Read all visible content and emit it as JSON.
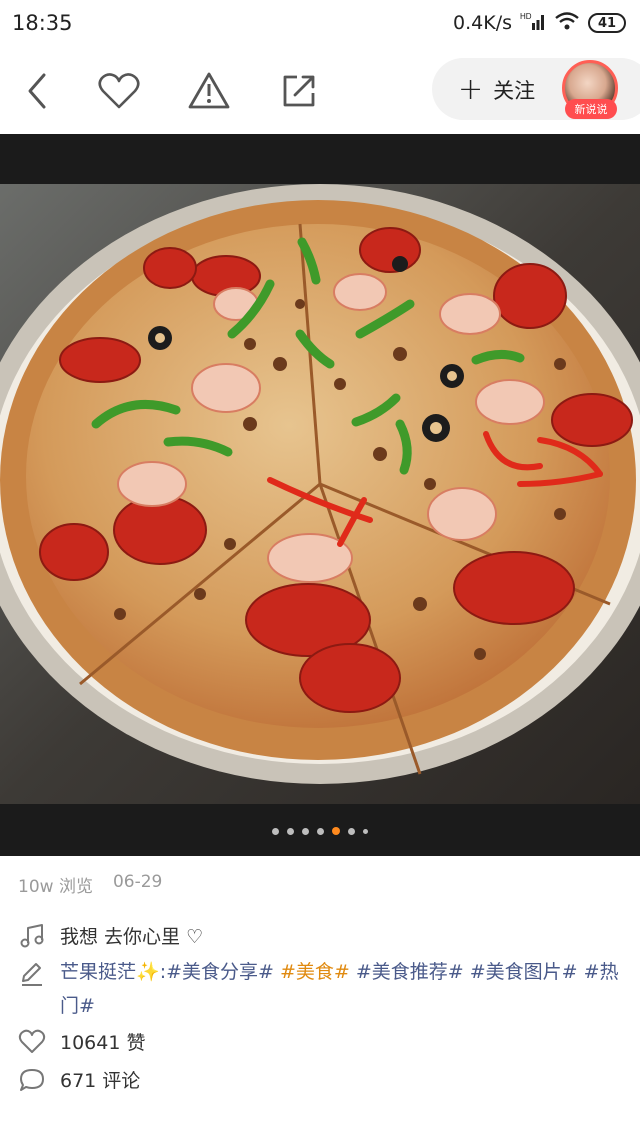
{
  "status_bar": {
    "time": "18:35",
    "net_speed": "0.4K/s",
    "network": "HD",
    "battery": "41"
  },
  "toolbar": {
    "follow_label": "关注",
    "avatar_badge": "新说说",
    "icons": [
      "back-icon",
      "heart-icon",
      "warning-icon",
      "share-icon"
    ]
  },
  "photo": {
    "description_icon": "pizza-photo",
    "page_dots": 7,
    "active_dot": 5
  },
  "meta": {
    "views": "10w 浏览",
    "date": "06-29"
  },
  "music": {
    "title": "我想  去你心里 ♡"
  },
  "post": {
    "author": "芒果挺茫",
    "sparkle": "✨",
    "colon": ":",
    "tags": [
      {
        "text": "#美食分享#",
        "color": "#4a5a8a"
      },
      {
        "text": "#美食#",
        "color": "#e08a10"
      },
      {
        "text": "#美食推荐#",
        "color": "#4a5a8a"
      },
      {
        "text": "#美食图片#",
        "color": "#4a5a8a"
      },
      {
        "text": "#热门#",
        "color": "#4a5a8a"
      }
    ]
  },
  "likes": "10641 赞",
  "comments": "671 评论"
}
